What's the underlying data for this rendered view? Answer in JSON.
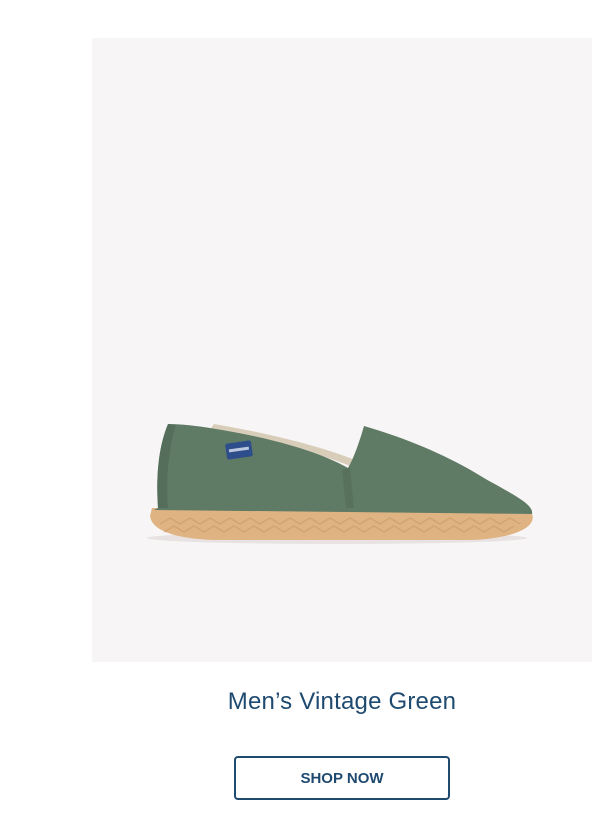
{
  "product": {
    "image_alt": "green espadrille shoe",
    "title": "Men’s Vintage Green",
    "shop_label": "SHOP NOW",
    "colors": {
      "brand_text": "#1f4a70",
      "image_background": "#f7f5f5",
      "shoe_canvas": "#5f7a65",
      "jute_sole": "#e0b482"
    }
  }
}
